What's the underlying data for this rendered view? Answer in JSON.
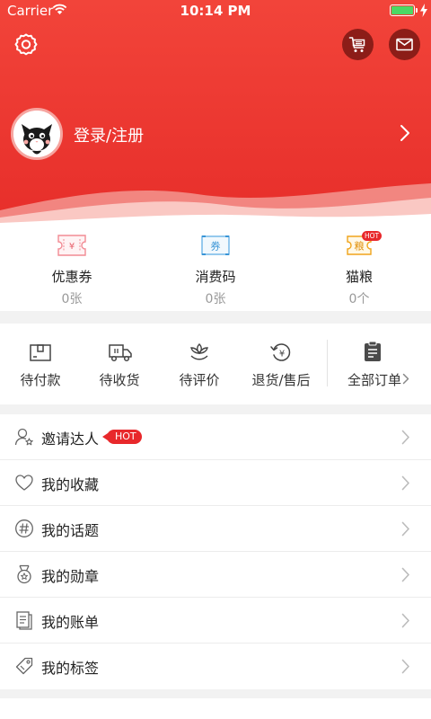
{
  "status_bar": {
    "carrier": "Carrier",
    "time": "10:14 PM"
  },
  "header": {
    "settings_icon": "settings-icon",
    "cart_icon": "shopping-cart-icon",
    "mail_icon": "mail-icon",
    "login_text": "登录/注册"
  },
  "assets": [
    {
      "name": "优惠券",
      "value": "0张",
      "icon": "coupon-icon"
    },
    {
      "name": "消费码",
      "value": "0张",
      "icon": "voucher-code-icon",
      "icon_text": "券"
    },
    {
      "name": "猫粮",
      "value": "0个",
      "icon": "cat-food-icon",
      "icon_text": "粮",
      "badge": "HOT"
    }
  ],
  "orders": [
    {
      "label": "待付款",
      "icon": "wallet-icon"
    },
    {
      "label": "待收货",
      "icon": "truck-icon"
    },
    {
      "label": "待评价",
      "icon": "flower-icon"
    },
    {
      "label": "退货/售后",
      "icon": "refund-icon"
    }
  ],
  "all_orders": {
    "label": "全部订单",
    "icon": "clipboard-icon"
  },
  "menu": [
    {
      "label": "邀请达人",
      "badge": "HOT",
      "icon": "invite-icon"
    },
    {
      "label": "我的收藏",
      "icon": "heart-icon"
    },
    {
      "label": "我的话题",
      "icon": "hashtag-icon"
    },
    {
      "label": "我的勋章",
      "icon": "medal-icon"
    },
    {
      "label": "我的账单",
      "icon": "bill-icon"
    },
    {
      "label": "我的标签",
      "icon": "tag-icon"
    }
  ],
  "colors": {
    "brand_red": "#e8282b",
    "dark_red_button": "#8c1d18",
    "battery_green": "#4cd964"
  }
}
